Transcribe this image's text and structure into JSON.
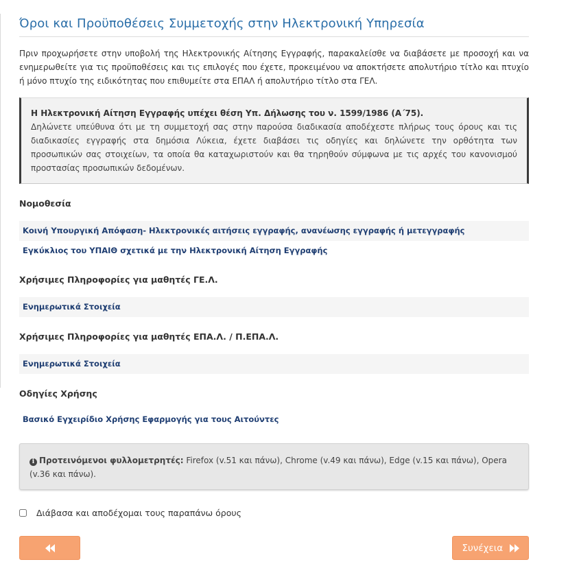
{
  "title": "Όροι και Προϋποθέσεις Συμμετοχής στην Ηλεκτρονική Υπηρεσία",
  "intro": "Πριν προχωρήσετε στην υποβολή της Ηλεκτρονικής Αίτησης Εγγραφής, παρακαλείσθε να διαβάσετε με προσοχή και να ενημερωθείτε για τις προϋποθέσεις και τις επιλογές που έχετε, προκειμένου να αποκτήσετε απολυτήριο τίτλο και πτυχίο ή μόνο πτυχίο της ειδικότητας που επιθυμείτε στα ΕΠΑΛ ή απολυτήριο τίτλο στα ΓΕΛ.",
  "declaration": {
    "title": "Η Ηλεκτρονική Αίτηση Εγγραφής υπέχει θέση Υπ. Δήλωσης του ν. 1599/1986 (Α΄75).",
    "body": "Δηλώνετε υπεύθυνα ότι με τη συμμετοχή σας στην παρούσα διαδικασία αποδέχεστε πλήρως τους όρους και τις διαδικασίες εγγραφής στα δημόσια Λύκεια, έχετε διαβάσει τις οδηγίες και δηλώνετε την ορθότητα των προσωπικών σας στοιχείων, τα οποία θα καταχωριστούν και θα τηρηθούν σύμφωνα με τις αρχές του κανονισμού προστασίας προσωπικών δεδομένων."
  },
  "sections": {
    "legislation": {
      "heading": "Νομοθεσία",
      "links": [
        "Κοινή Υπουργική Απόφαση- Ηλεκτρονικές αιτήσεις εγγραφής, ανανέωσης εγγραφής ή μετεγγραφής",
        "Εγκύκλιος του ΥΠΑΙΘ σχετικά με την Ηλεκτρονική Αίτηση Εγγραφής"
      ]
    },
    "gel": {
      "heading": "Χρήσιμες Πληροφορίες για μαθητές ΓΕ.Λ.",
      "links": [
        "Ενημερωτικά Στοιχεία"
      ]
    },
    "epal": {
      "heading": "Χρήσιμες Πληροφορίες για μαθητές ΕΠΑ.Λ. / Π.ΕΠΑ.Λ.",
      "links": [
        "Ενημερωτικά Στοιχεία"
      ]
    },
    "guide": {
      "heading": "Οδηγίες Χρήσης",
      "links": [
        "Βασικό Εγχειρίδιο Χρήσης Εφαρμογής για τους Αιτούντες"
      ]
    }
  },
  "browsers": {
    "label": "Προτεινόμενοι φυλλομετρητές:",
    "text": "Firefox (v.51 και πάνω), Chrome (v.49 και πάνω), Edge (v.15 και πάνω), Opera (v.36 και πάνω)."
  },
  "agreement": {
    "label": "Διάβασα και αποδέχομαι τους παραπάνω όρους",
    "checked": false
  },
  "buttons": {
    "back_icon": "double-chevron-left-icon",
    "next_label": "Συνέχεια",
    "next_icon": "double-chevron-right-icon"
  },
  "colors": {
    "title": "#2a6ea8",
    "link": "#1f3e72",
    "button": "#f7a371"
  }
}
